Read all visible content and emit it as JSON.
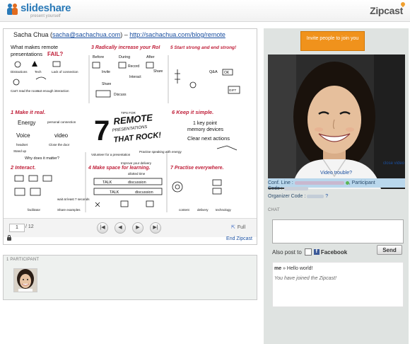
{
  "header": {
    "logo_name": "slideshare",
    "logo_tagline": "present yourself",
    "right_brand": "Zipcast"
  },
  "document": {
    "author": "Sacha Chua",
    "email": "sacha@sachachua.com",
    "separator": "–",
    "url": "http://sachachua.com/blog/remote",
    "page": "1",
    "total_pages": "/ 12",
    "full_label": "Full",
    "end_label": "End Zipcast"
  },
  "slide": {
    "title_main_big": "7",
    "title_small": "TIPS FOR",
    "title_remote": "REMOTE",
    "title_presentations": "PRESENTATIONS",
    "title_rock": "THAT ROCK!",
    "q_title_1": "What makes remote",
    "q_title_2": "presentations",
    "q_title_3": "FAIL?",
    "q_items": [
      "Distractions",
      "Tech",
      "Lack of connection",
      "Can't read the room",
      "not enough interaction"
    ],
    "tip1": "1 Make it real.",
    "tip1_items": [
      "Energy",
      "personal connection",
      "Voice",
      "video",
      "headset",
      "Stand up",
      "Close the door",
      "Why does it matter?"
    ],
    "tip2": "2 Interact.",
    "tip2_items": [
      "wait at least 7 seconds",
      "facilitator",
      "Share examples"
    ],
    "tip3": "3 Radically increase your RoI",
    "tip3_items": [
      "Before",
      "During",
      "After",
      "Invite",
      "Record",
      "Share",
      "Share",
      "Interact",
      "Discuss"
    ],
    "tip4": "4 Make space for learning.",
    "tip4_items": [
      "allotted time",
      "TALK",
      "discussion",
      "TALK",
      "discussion"
    ],
    "tip5": "5 Start strong and end strong!",
    "tip5_items": [
      "Q&A",
      "OK",
      "GIFT"
    ],
    "tip6": "6 Keep it simple.",
    "tip6_items": [
      "1 key point",
      "memory devices",
      "Clear next actions"
    ],
    "tip7": "7 Practise everywhere.",
    "tip7_items": [
      "content",
      "delivery",
      "technology"
    ],
    "middle_items": [
      "Volunteer for a presentation",
      "Practise speaking with energy",
      "Improve your delivery"
    ]
  },
  "participants": {
    "label": "1 PARTICIPANT"
  },
  "right_panel": {
    "invite_label": "Invite people to join you",
    "close_video": "close video",
    "video_trouble": "Video trouble?",
    "conf_line_label": "Conf. Line :",
    "conf_line_suffix": ", Participant",
    "code_label": "Code :",
    "organizer_label": "Organizer Code :",
    "organizer_suffix": "?",
    "chat_label": "CHAT",
    "also_post": "Also post to",
    "facebook_label": "Facebook",
    "facebook_letter": "f",
    "send_label": "Send",
    "messages": [
      {
        "user": "me",
        "separator": " » ",
        "text": "Hello world!"
      },
      {
        "text": "You have joined the Zipcast!"
      }
    ]
  },
  "colors": {
    "brand_blue": "#2a7ab8",
    "brand_orange": "#e26c1f",
    "invite_orange": "#f0921c",
    "link_blue": "#1a4fa0",
    "conf_bg": "#b9d7ec",
    "panel_bg": "#dfe3e1",
    "sketch_red": "#c0203a"
  },
  "icons": {
    "first": "skip-back-icon",
    "prev": "previous-icon",
    "next": "next-icon",
    "last": "skip-forward-icon",
    "fullscreen": "fullscreen-icon",
    "lock": "lock-icon",
    "facebook": "facebook-icon",
    "webcam": "webcam-icon"
  }
}
